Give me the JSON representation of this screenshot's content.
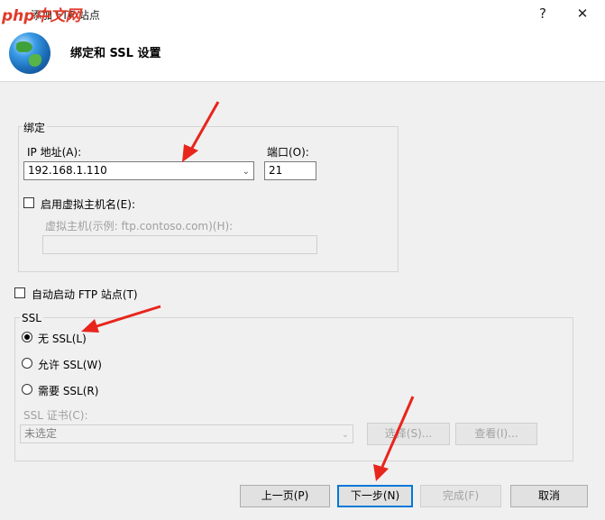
{
  "titlebar": {
    "watermark": "php中文网",
    "title": "添加 FTP 站点",
    "help": "?",
    "close": "✕"
  },
  "header": {
    "heading": "绑定和 SSL 设置"
  },
  "binding": {
    "group_label": "绑定",
    "ip_label": "IP 地址(A):",
    "ip_value": "192.168.1.110",
    "port_label": "端口(O):",
    "port_value": "21",
    "virtual_host_checkbox": "启用虚拟主机名(E):",
    "virtual_host_label": "虚拟主机(示例: ftp.contoso.com)(H):",
    "virtual_host_value": ""
  },
  "auto_start": {
    "label": "自动启动 FTP 站点(T)"
  },
  "ssl": {
    "group_label": "SSL",
    "options": [
      "无 SSL(L)",
      "允许 SSL(W)",
      "需要 SSL(R)"
    ],
    "selected_index": 0,
    "cert_label": "SSL 证书(C):",
    "cert_value": "未选定",
    "select_button": "选择(S)...",
    "view_button": "查看(I)..."
  },
  "footer": {
    "prev": "上一页(P)",
    "next": "下一步(N)",
    "finish": "完成(F)",
    "cancel": "取消"
  },
  "colors": {
    "annotation_arrow": "#e8251c",
    "focus_border": "#0078d7"
  }
}
